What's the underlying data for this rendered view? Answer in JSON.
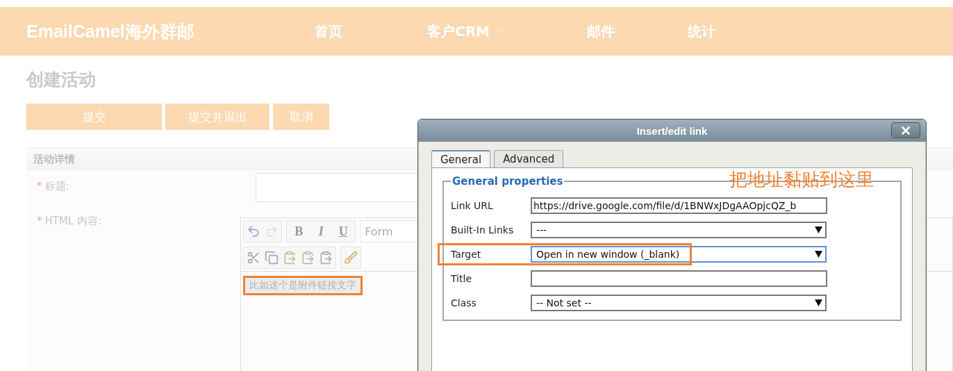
{
  "header": {
    "logo": "EmailCamel海外群邮",
    "nav": [
      {
        "label": "首页",
        "has_menu": false
      },
      {
        "label": "客户CRM",
        "has_menu": true
      },
      {
        "label": "邮件",
        "has_menu": true
      },
      {
        "label": "统计",
        "has_menu": false
      }
    ]
  },
  "page": {
    "title": "创建活动",
    "buttons": [
      "提交",
      "提交并退出",
      "取消"
    ],
    "section": "活动详情",
    "fields": [
      {
        "label": "标题:",
        "required_mark": "*",
        "kind": "input"
      },
      {
        "label": "HTML 内容:",
        "required_mark": "*",
        "kind": "editor"
      }
    ]
  },
  "editor": {
    "format_buttons": [
      "B",
      "I",
      "U"
    ],
    "format_select": "Form",
    "content": "比如这个是附件链接文字",
    "content_highlighted": true
  },
  "dialog": {
    "title": "Insert/edit link",
    "tabs": [
      {
        "label": "General",
        "selected": true
      },
      {
        "label": "Advanced",
        "selected": false
      }
    ],
    "legend": "General properties",
    "rows": [
      {
        "label": "Link URL",
        "kind": "input",
        "value": "https://drive.google.com/file/d/1BNWxJDgAAOpjcQZ_b",
        "focused": false,
        "highlighted": false
      },
      {
        "label": "Built-In Links",
        "kind": "select",
        "value": "---",
        "focused": false,
        "highlighted": false
      },
      {
        "label": "Target",
        "kind": "select",
        "value": "Open in new window (_blank)",
        "focused": true,
        "highlighted": true
      },
      {
        "label": "Title",
        "kind": "input",
        "focused": false,
        "highlighted": false
      },
      {
        "label": "Class",
        "kind": "select",
        "value": "-- Not set --",
        "focused": false,
        "highlighted": false
      }
    ]
  },
  "annotation": "把地址黏贴到这里"
}
